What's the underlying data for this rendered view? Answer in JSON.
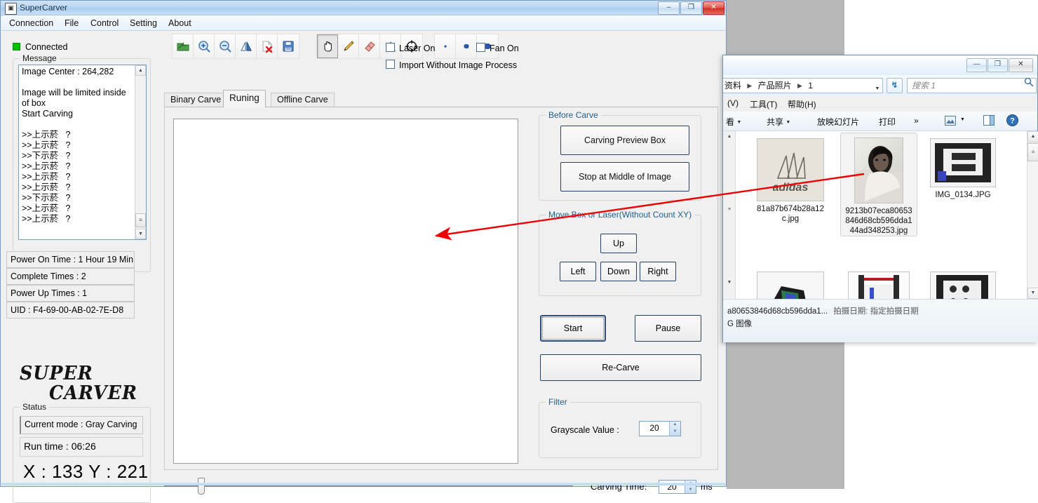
{
  "carver": {
    "title": "SuperCarver",
    "window_buttons": [
      "–",
      "❐",
      "✕"
    ],
    "menu": [
      "Connection",
      "File",
      "Control",
      "Setting",
      "About"
    ],
    "connection_status": "Connected",
    "message_group_title": "Message",
    "message_log": "Image Center : 264,282\n\nImage will be limited inside\nof box\nStart Carving\n\n>>上示菸   ?\n>>上示菸   ?\n>>下示菸   ?\n>>上示菸   ?\n>>上示菸   ?\n>>上示菸   ?\n>>下示菸   ?\n>>上示菸   ?\n>>上示菸   ?",
    "info_lines": [
      "Power On Time : 1 Hour 19 Min",
      "Complete Times : 2",
      "Power Up Times : 1",
      "UID : F4-69-00-AB-02-7E-D8"
    ],
    "logo_line1": "SUPER",
    "logo_line2": "CARVER",
    "status_group_title": "Status",
    "status_mode": "Current mode : Gray Carving",
    "status_runtime": "Run time :  06:26",
    "status_xy": "X : 133  Y : 221",
    "toolbar": [
      {
        "name": "open-file-icon",
        "glyph": "open"
      },
      {
        "name": "zoom-in-icon",
        "glyph": "zoom-in"
      },
      {
        "name": "zoom-out-icon",
        "glyph": "zoom-out"
      },
      {
        "name": "flip-image-icon",
        "glyph": "flip"
      },
      {
        "name": "delete-file-icon",
        "glyph": "delete"
      },
      {
        "name": "save-icon",
        "glyph": "save"
      },
      {
        "name": "pan-hand-icon",
        "glyph": "hand",
        "pressed": true
      },
      {
        "name": "pencil-icon",
        "glyph": "pencil"
      },
      {
        "name": "eraser-icon",
        "glyph": "eraser"
      },
      {
        "name": "text-tool-icon",
        "glyph": "letter-a"
      },
      {
        "name": "crosshair-icon",
        "glyph": "crosshair"
      },
      {
        "name": "brush-size-small-icon",
        "glyph": "dot-small"
      },
      {
        "name": "brush-size-medium-icon",
        "glyph": "dot-medium"
      },
      {
        "name": "brush-size-large-icon",
        "glyph": "dot-large"
      }
    ],
    "tabs": [
      {
        "label": "Binary Carve",
        "active": false
      },
      {
        "label": "Runing",
        "active": true
      },
      {
        "label": "Offline Carve",
        "active": false
      }
    ],
    "checkboxes": [
      {
        "label": "Laser On",
        "checked": false
      },
      {
        "label": "Fan On",
        "checked": false
      },
      {
        "label": "Import Without  Image Process",
        "checked": false
      }
    ],
    "before_carve": {
      "group_title": "Before Carve",
      "buttons": [
        "Carving Preview Box",
        "Stop at Middle of Image"
      ]
    },
    "move_box": {
      "group_title": "Move Box or Laser(Without Count XY)",
      "up": "Up",
      "left": "Left",
      "down": "Down",
      "right": "Right"
    },
    "action_buttons": {
      "start": "Start",
      "pause": "Pause",
      "recarve": "Re-Carve"
    },
    "filter": {
      "group_title": "Filter",
      "label": "Grayscale Value :",
      "value": "20"
    },
    "bottom": {
      "carving_time_label": "Carving Time:",
      "carving_time_value": "20",
      "unit": "ms",
      "slider_percent": 8
    },
    "accent_group_color": "#21618c",
    "accent_border_color": "#25436a"
  },
  "explorer": {
    "window_buttons": [
      "—",
      "❐",
      "✕"
    ],
    "breadcrumb": [
      "资料",
      "产品照片",
      "1"
    ],
    "search_placeholder": "搜索 1",
    "menu": [
      "(V)",
      "工具(T)",
      "帮助(H)"
    ],
    "toolbar": [
      "看",
      "共享",
      "放映幻灯片",
      "打印",
      "»"
    ],
    "files": [
      {
        "name": "81a87b674b28a12c.jpg",
        "selected": false,
        "thumb": "adidas"
      },
      {
        "name": "9213b07eca80653846d68cb596dda144ad348253.jpg",
        "selected": true,
        "thumb": "portrait"
      },
      {
        "name": "IMG_0134.JPG",
        "selected": false,
        "thumb": "printer-a"
      },
      {
        "name": "",
        "selected": false,
        "thumb": "printer-b"
      },
      {
        "name": "",
        "selected": false,
        "thumb": "printer-c"
      },
      {
        "name": "",
        "selected": false,
        "thumb": "printer-d"
      }
    ],
    "details_line1": "a80653846d68cb596dda1...",
    "details_date": "拍摄日期: 指定拍摄日期",
    "details_line2": "G 图像"
  }
}
